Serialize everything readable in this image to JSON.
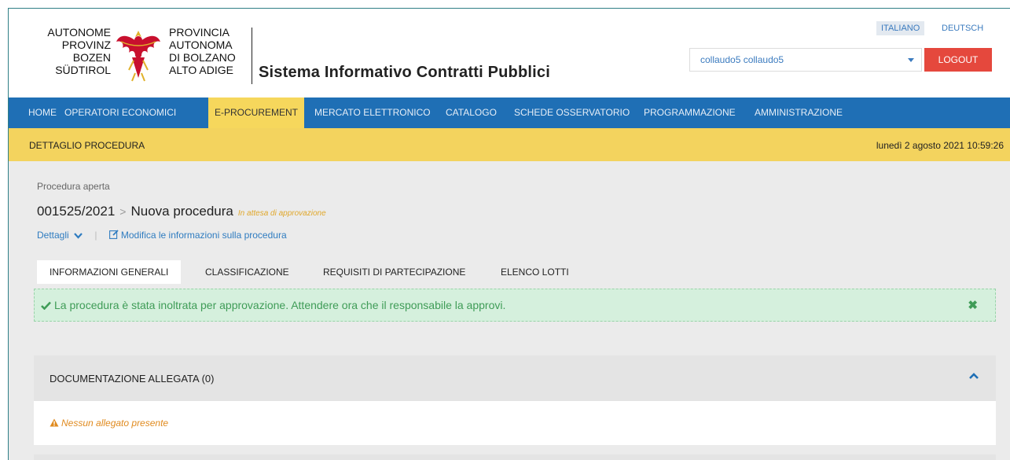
{
  "header": {
    "logo_left": [
      "AUTONOME",
      "PROVINZ",
      "BOZEN",
      "SÜDTIROL"
    ],
    "logo_right": [
      "PROVINCIA",
      "AUTONOMA",
      "DI BOLZANO",
      "ALTO ADIGE"
    ],
    "app_title": "Sistema Informativo Contratti Pubblici",
    "lang_it": "ITALIANO",
    "lang_de": "DEUTSCH",
    "user": "collaudo5 collaudo5",
    "logout": "LOGOUT"
  },
  "nav": {
    "items": [
      "HOME",
      "OPERATORI ECONOMICI",
      "E-PROCUREMENT",
      "MERCATO ELETTRONICO",
      "CATALOGO",
      "SCHEDE OSSERVATORIO",
      "PROGRAMMAZIONE",
      "AMMINISTRAZIONE"
    ],
    "active": "E-PROCUREMENT"
  },
  "subbar": {
    "section": "DETTAGLIO PROCEDURA",
    "datetime": "lunedì 2 agosto 2021 10:59:26"
  },
  "procedure": {
    "type": "Procedura aperta",
    "code": "001525/2021",
    "separator": ">",
    "name": "Nuova procedura",
    "status": "In attesa di approvazione",
    "details_link": "Dettagli",
    "edit_link": "Modifica le informazioni sulla procedura"
  },
  "tabs": [
    "INFORMAZIONI GENERALI",
    "CLASSIFICAZIONE",
    "REQUISITI DI PARTECIPAZIONE",
    "ELENCO LOTTI"
  ],
  "alert": {
    "message": "La procedura è stata inoltrata per approvazione. Attendere ora che il responsabile la approvi.",
    "close": "✖"
  },
  "panel": {
    "title": "DOCUMENTAZIONE ALLEGATA (0)",
    "empty": "Nessun allegato presente"
  },
  "colors": {
    "nav_bg": "#1f6fb5",
    "nav_active": "#f6d75c",
    "subbar_bg": "#f3d35e",
    "logout_bg": "#e5483d",
    "alert_bg": "#d5f0dd",
    "alert_text": "#3f9c57",
    "warning": "#e08a1e"
  }
}
